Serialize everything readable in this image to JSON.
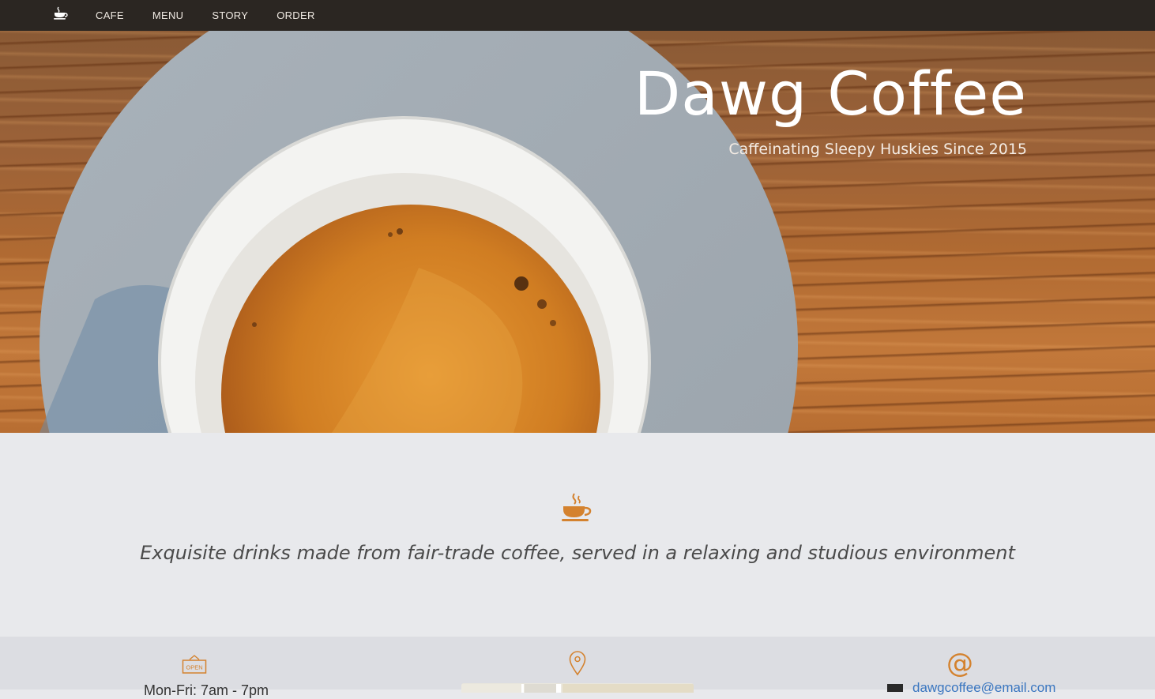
{
  "nav": {
    "logo_icon": "coffee-cup-icon",
    "links": [
      "Cafe",
      "Menu",
      "Story",
      "Order"
    ]
  },
  "hero": {
    "title": "Dawg Coffee",
    "subtitle": "Caffeinating Sleepy Huskies Since 2015"
  },
  "about": {
    "icon": "steaming-coffee-icon",
    "tagline": "Exquisite drinks made from fair-trade coffee, served in a relaxing and studious environment"
  },
  "info": {
    "hours_icon": "open-sign-icon",
    "hours_sign_text": "OPEN",
    "hours_text": "Mon-Fri: 7am - 7pm",
    "location_icon": "map-pin-icon",
    "contact_icon": "at-sign-icon",
    "email": "dawgcoffee@email.com"
  },
  "colors": {
    "accent": "#d4822e",
    "navbar": "#2b2622",
    "section_bg": "#e8e9ec",
    "info_bg": "#dcdde2",
    "link": "#3a76c0"
  }
}
